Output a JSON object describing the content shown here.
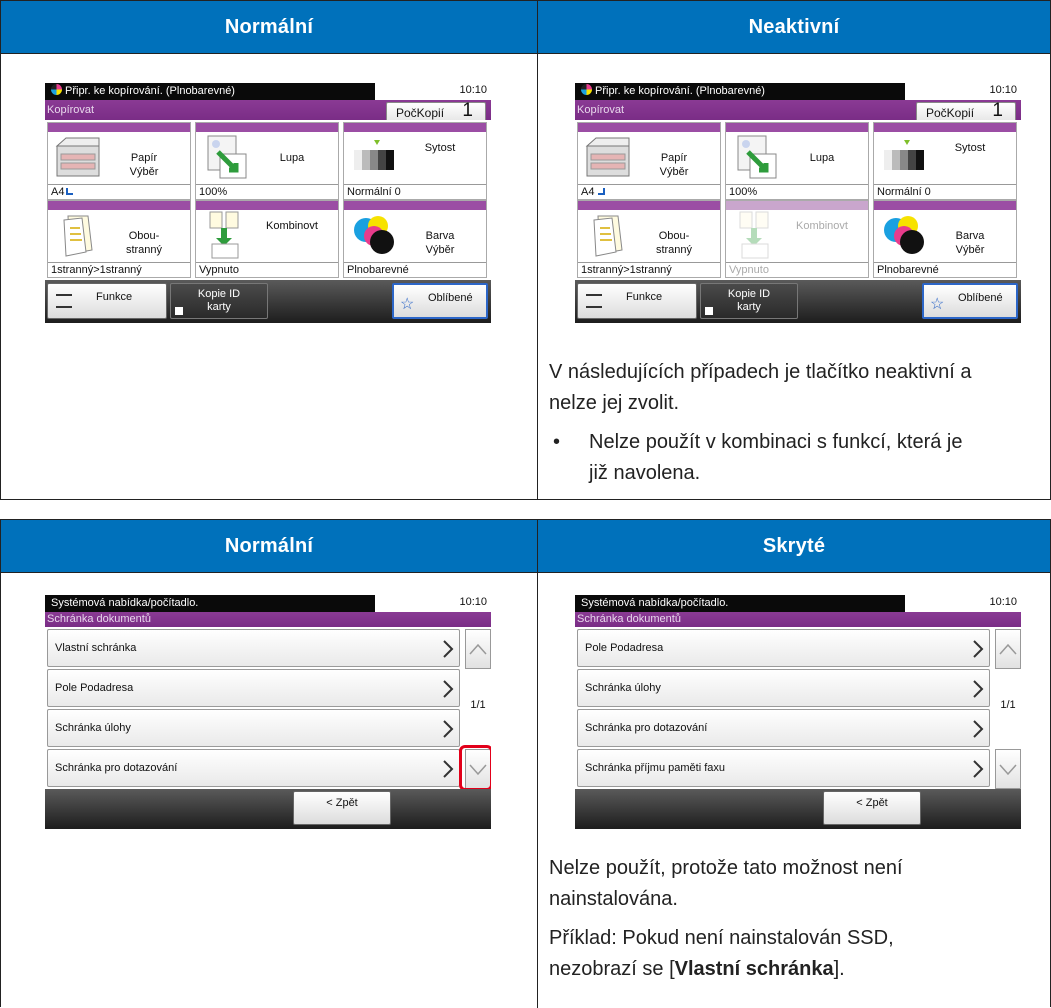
{
  "table1": {
    "headers": [
      "Normální",
      "Neaktivní"
    ],
    "copy_screen": {
      "status": "Připr. ke kopírování. (Plnobarevné)",
      "time": "10:10",
      "function_title": "Kopírovat",
      "copies_label": "PočKopií",
      "copies_value": "1",
      "tiles": [
        {
          "label1": "Papír",
          "label2": "Výběr",
          "value": "A4"
        },
        {
          "label1": "Lupa",
          "label2": "",
          "value": "100%"
        },
        {
          "label1": "Sytost",
          "label2": "",
          "value": "Normální 0"
        },
        {
          "label1": "Obou-",
          "label2": "stranný",
          "value": "1stranný>1stranný"
        },
        {
          "label1": "Kombinovt",
          "label2": "",
          "value": "Vypnuto"
        },
        {
          "label1": "Barva",
          "label2": "Výběr",
          "value": "Plnobarevné"
        }
      ],
      "buttons": {
        "functions": "Funkce",
        "id_copy1": "Kopie ID",
        "id_copy2": "karty",
        "favorites": "Oblíbené"
      }
    },
    "note_line1": "V následujících případech je tlačítko neaktivní a",
    "note_line2": "nelze jej zvolit.",
    "bullet": "•",
    "bullet_line1": "Nelze použít v kombinaci s funkcí, která je",
    "bullet_line2": "již navolena."
  },
  "table2": {
    "headers": [
      "Normální",
      "Skryté"
    ],
    "box_screen": {
      "status": "Systémová nabídka/počítadlo.",
      "time": "10:10",
      "function_title": "Schránka dokumentů",
      "page": "1/1",
      "back": "< Zpět",
      "items_normal": [
        "Vlastní schránka",
        "Pole Podadresa",
        "Schránka úlohy",
        "Schránka pro dotazování"
      ],
      "items_hidden": [
        "Pole Podadresa",
        "Schránka úlohy",
        "Schránka pro dotazování",
        "Schránka příjmu paměti faxu"
      ]
    },
    "note_line1": "Nelze použít, protože tato možnost není",
    "note_line2": "nainstalována.",
    "example_line1": "Příklad: Pokud není nainstalován SSD,",
    "example_pre": "nezobrazí se [",
    "example_bold": "Vlastní schránka",
    "example_post": "]."
  },
  "colors": {
    "header_blue": "#0071bb",
    "tile_purple": "#9b4ea4",
    "highlight_red": "#e2001a"
  }
}
